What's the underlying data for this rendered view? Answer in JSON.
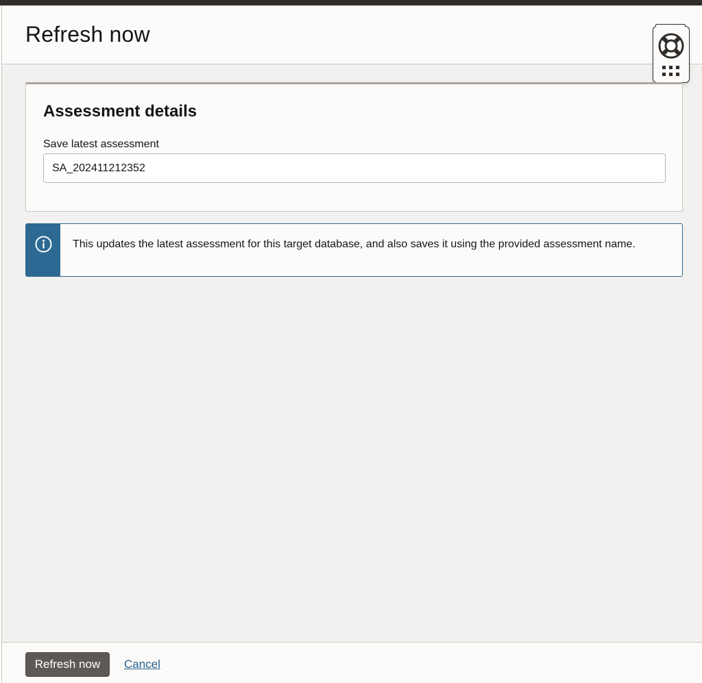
{
  "panel": {
    "title": "Refresh now"
  },
  "card": {
    "title": "Assessment details",
    "field_label": "Save latest assessment",
    "field_value": "SA_202411212352"
  },
  "info": {
    "message": "This updates the latest assessment for this target database, and also saves it using the provided assessment name."
  },
  "footer": {
    "primary_label": "Refresh now",
    "cancel_label": "Cancel"
  },
  "colors": {
    "info_accent": "#2c6a93",
    "primary_button": "#5f5955",
    "link": "#26608c"
  },
  "icons": {
    "help": "lifebuoy-icon",
    "apps": "apps-grid-icon",
    "info": "info-icon"
  }
}
